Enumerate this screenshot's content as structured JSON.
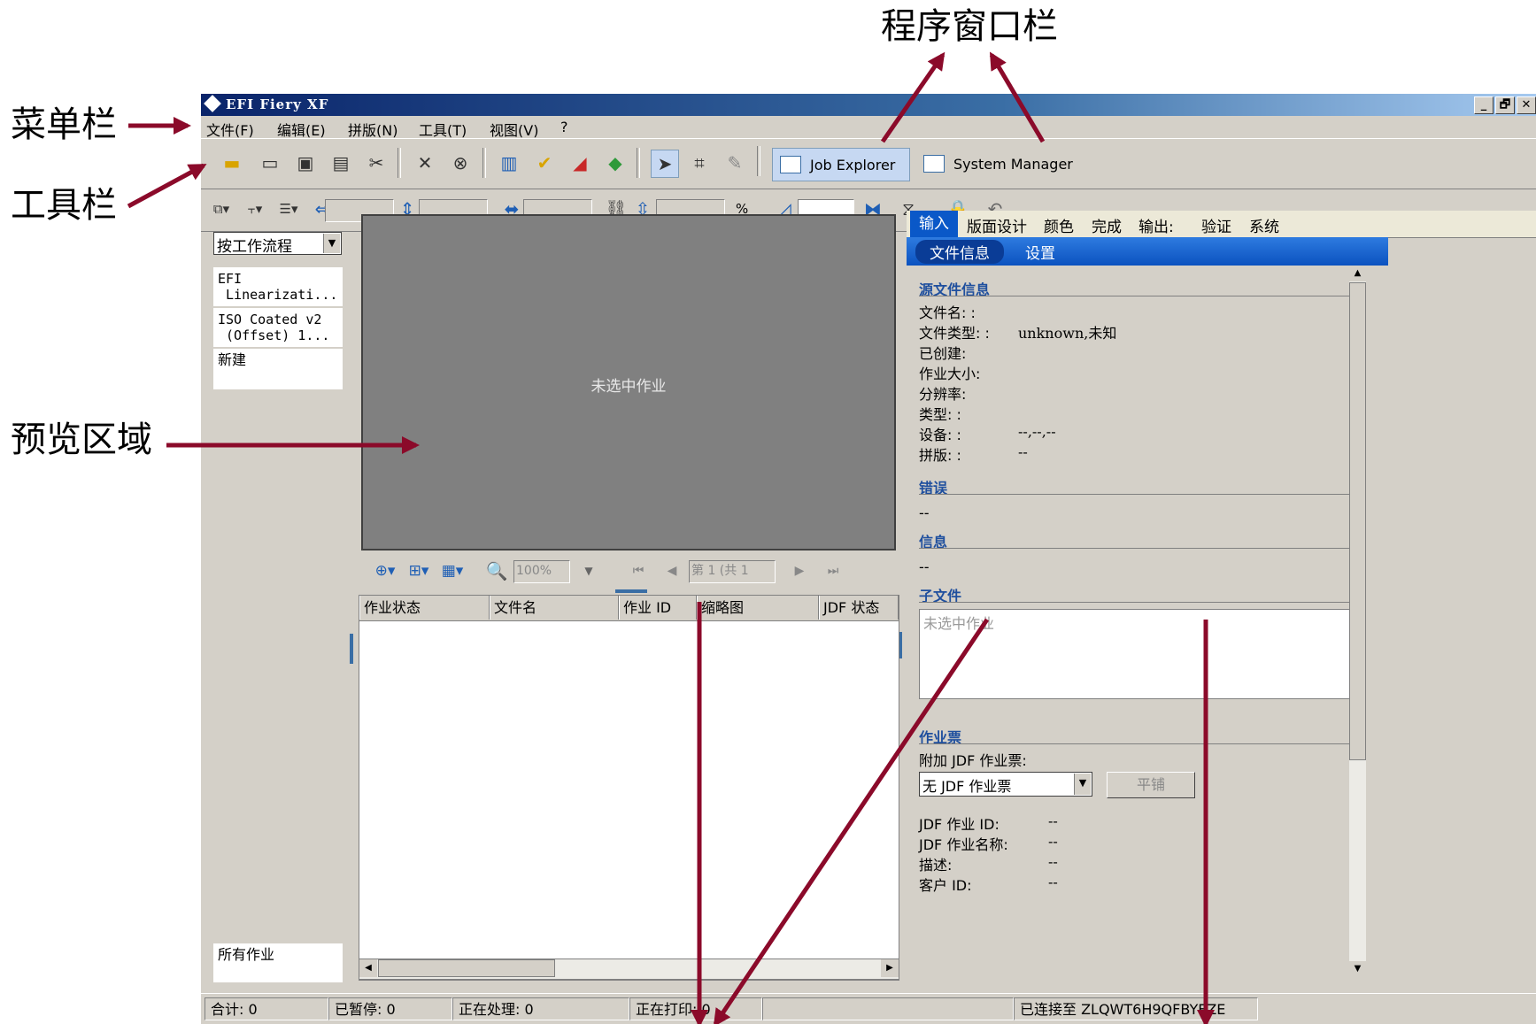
{
  "annotations": {
    "program_window_bar": "程序窗口栏",
    "menu_bar": "菜单栏",
    "toolbar": "工具栏",
    "preview_area": "预览区域"
  },
  "window": {
    "title": "EFI Fiery XF",
    "controls": [
      "_",
      "🗗",
      "✕"
    ]
  },
  "menu": [
    "文件(F)",
    "编辑(E)",
    "拼版(N)",
    "工具(T)",
    "视图(V)",
    "?"
  ],
  "toolbar": {
    "job_explorer_label": "Job Explorer",
    "system_manager_label": "System Manager",
    "percent_label": "%"
  },
  "left_panel": {
    "workflow_filter": "按工作流程",
    "workflows": [
      "EFI\n Linearizati...",
      "ISO Coated v2\n (Offset) 1...",
      "新建"
    ],
    "all_jobs": "所有作业"
  },
  "preview": {
    "empty_message": "未选中作业",
    "zoom_value": "100%",
    "page_indicator": "第 1 (共 1"
  },
  "job_list": {
    "columns": [
      "作业状态",
      "文件名",
      "作业 ID",
      "缩略图",
      "JDF 状态"
    ]
  },
  "right_panel": {
    "tabs": [
      "输入",
      "版面设计",
      "颜色",
      "完成",
      "输出:",
      "验证",
      "系统"
    ],
    "subtabs": [
      "文件信息",
      "设置"
    ],
    "source_info": {
      "title": "源文件信息",
      "fields": [
        {
          "label": "文件名: :",
          "value": ""
        },
        {
          "label": "文件类型: :",
          "value": "unknown,未知"
        },
        {
          "label": "已创建:",
          "value": ""
        },
        {
          "label": "作业大小:",
          "value": ""
        },
        {
          "label": "分辨率:",
          "value": ""
        },
        {
          "label": "类型: :",
          "value": ""
        },
        {
          "label": "设备: :",
          "value": "--,--,--"
        },
        {
          "label": "拼版: :",
          "value": "--"
        }
      ]
    },
    "errors": {
      "title": "错误",
      "value": "--"
    },
    "info": {
      "title": "信息",
      "value": "--"
    },
    "subfiles": {
      "title": "子文件",
      "placeholder": "未选中作业"
    },
    "job_ticket": {
      "title": "作业票",
      "attach_label": "附加 JDF 作业票:",
      "select_value": "无 JDF 作业票",
      "tile_button": "平铺",
      "fields": [
        {
          "label": "JDF 作业 ID:",
          "value": "--"
        },
        {
          "label": "JDF 作业名称:",
          "value": "--"
        },
        {
          "label": "描述:",
          "value": "--"
        },
        {
          "label": "客户 ID:",
          "value": "--"
        }
      ]
    }
  },
  "statusbar": {
    "total": "合计: 0",
    "paused": "已暂停: 0",
    "processing": "正在处理: 0",
    "printing": "正在打印: 0",
    "connection": "已连接至 ZLQWT6H9QFBYEZE"
  }
}
